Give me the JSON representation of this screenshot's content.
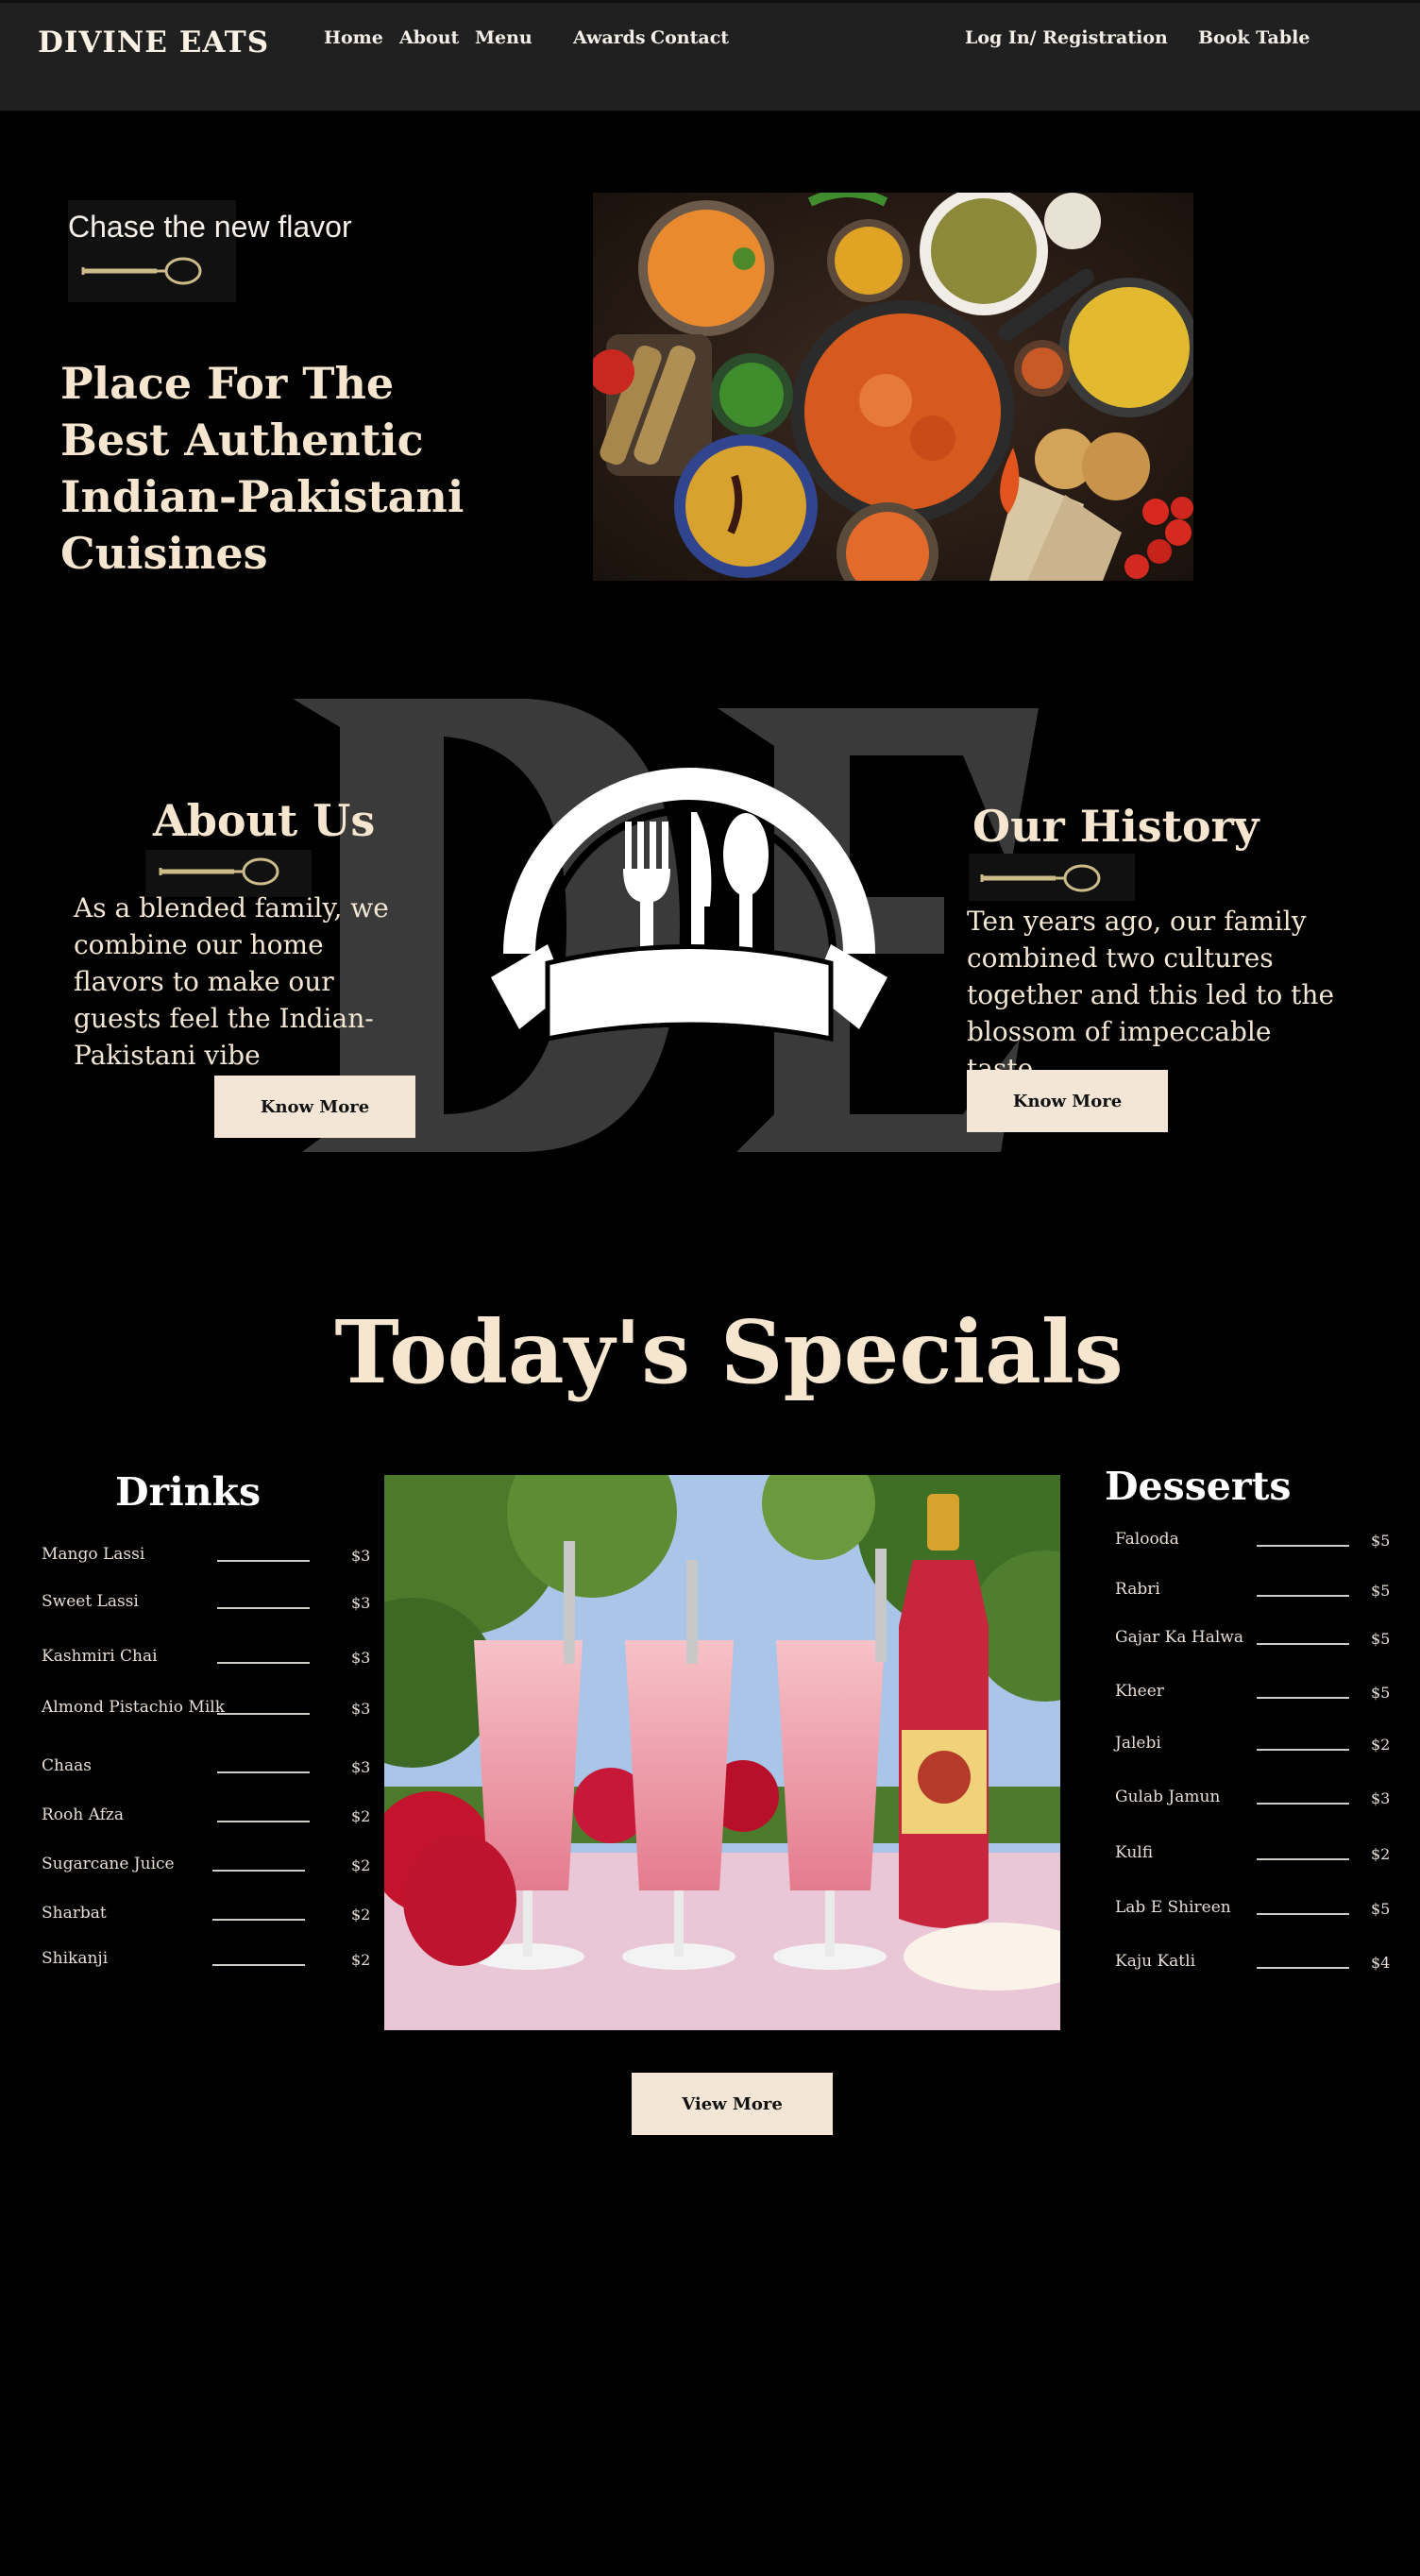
{
  "nav": {
    "brand": "DIVINE EATS",
    "links": [
      "Home",
      "About",
      "Menu",
      "Awards",
      "Contact"
    ],
    "login": "Log In/ Registration",
    "book": "Book Table"
  },
  "hero": {
    "tagline": "Chase the new flavor",
    "title": "Place For The Best Authentic Indian-Pakistani Cuisines"
  },
  "about": {
    "heading": "About Us",
    "text": "As a blended family, we combine our home flavors to make our guests feel the Indian-Pakistani vibe",
    "button": "Know More"
  },
  "history": {
    "heading": "Our History",
    "text": "Ten years ago, our family combined two cultures together and this led to the blossom of impeccable taste",
    "button": "Know More"
  },
  "specials": {
    "title": "Today's Specials",
    "drinks_heading": "Drinks",
    "desserts_heading": "Desserts",
    "drinks": [
      {
        "name": "Mango Lassi",
        "price": "$3"
      },
      {
        "name": "Sweet Lassi",
        "price": "$3"
      },
      {
        "name": "Kashmiri Chai",
        "price": "$3"
      },
      {
        "name": "Almond Pistachio Milk",
        "price": "$3"
      },
      {
        "name": "Chaas",
        "price": "$3"
      },
      {
        "name": "Rooh Afza",
        "price": "$2"
      },
      {
        "name": "Sugarcane Juice",
        "price": "$2"
      },
      {
        "name": "Sharbat",
        "price": "$2"
      },
      {
        "name": "Shikanji",
        "price": "$2"
      }
    ],
    "desserts": [
      {
        "name": "Falooda",
        "price": "$5"
      },
      {
        "name": "Rabri",
        "price": "$5"
      },
      {
        "name": "Gajar Ka Halwa",
        "price": "$5"
      },
      {
        "name": "Kheer",
        "price": "$5"
      },
      {
        "name": "Jalebi",
        "price": "$2"
      },
      {
        "name": "Gulab Jamun",
        "price": "$3"
      },
      {
        "name": "Kulfi",
        "price": "$2"
      },
      {
        "name": "Lab E Shireen",
        "price": "$5"
      },
      {
        "name": "Kaju Katli",
        "price": "$4"
      }
    ],
    "view_more": "View More"
  },
  "colors": {
    "background": "#000000",
    "navbar": "#202020",
    "cream": "#f6e6cf",
    "button": "#f3e6d6",
    "spoon": "#cdbb8a"
  }
}
